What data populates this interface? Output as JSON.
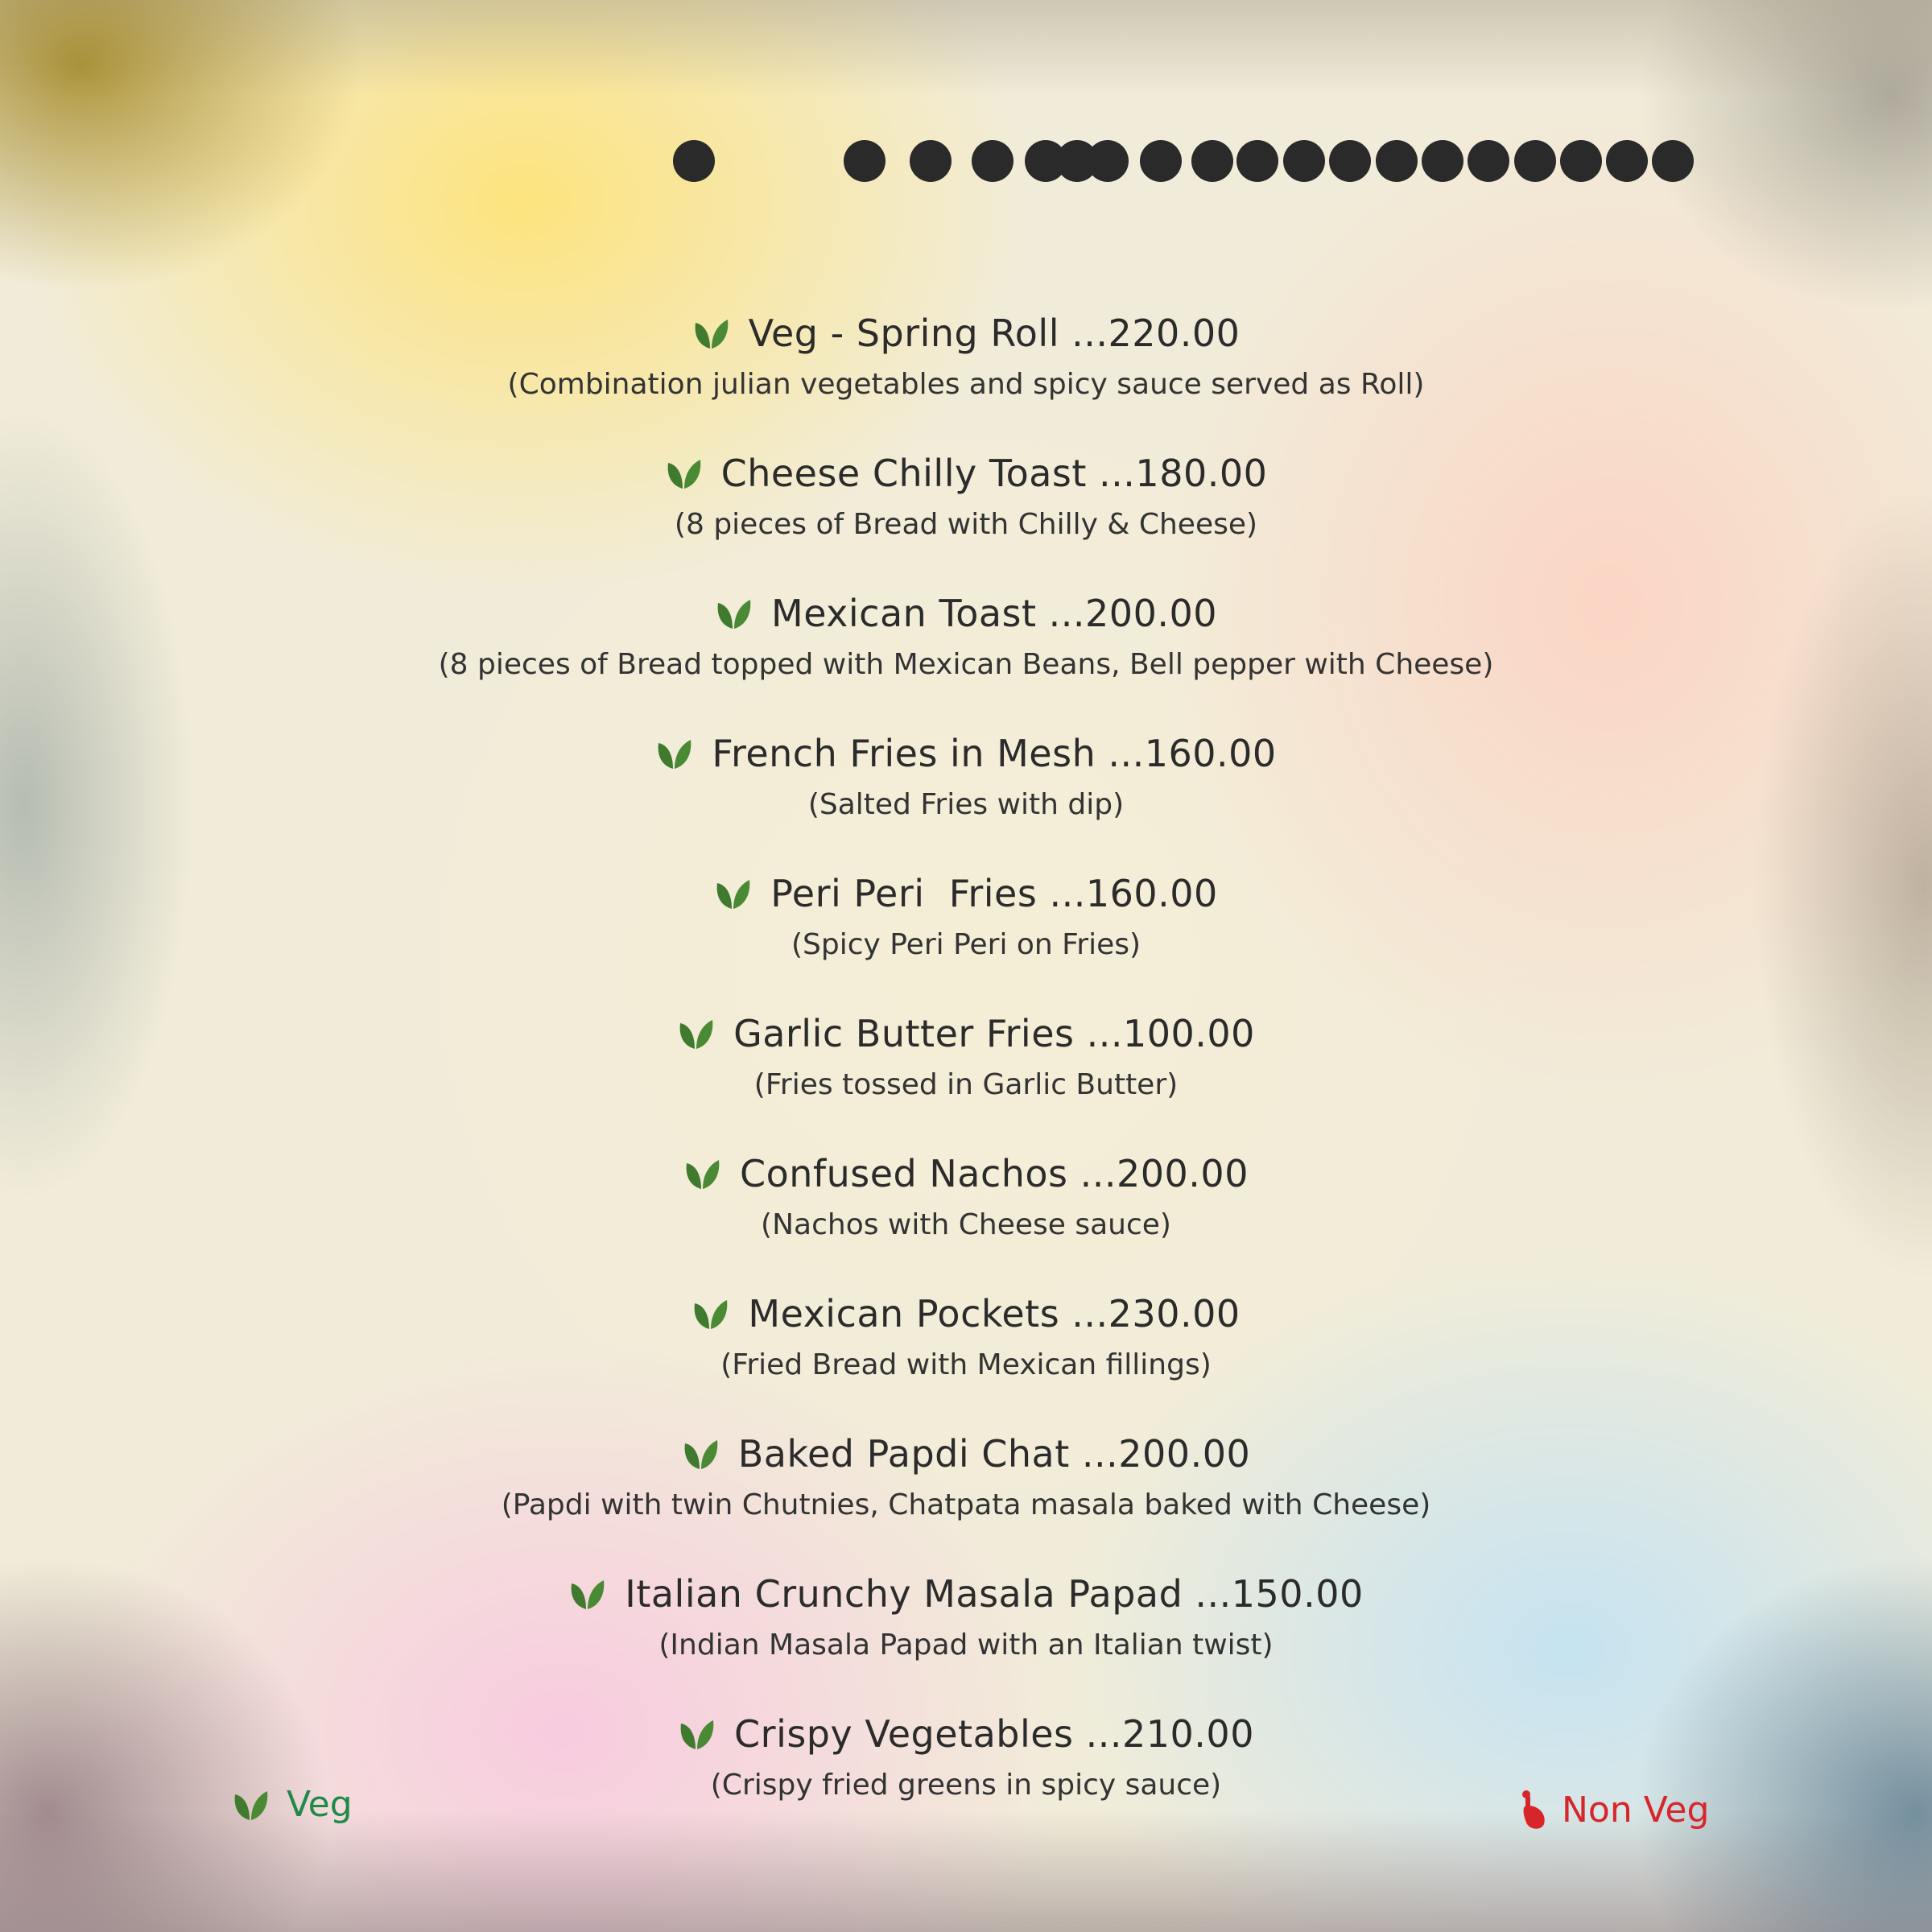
{
  "menu": {
    "items": [
      {
        "name": "Veg - Spring Roll ...220.00",
        "description": "(Combination julian vegetables and spicy sauce served as Roll)",
        "type": "veg"
      },
      {
        "name": "Cheese Chilly Toast ...180.00",
        "description": "(8 pieces of Bread with Chilly & Cheese)",
        "type": "veg"
      },
      {
        "name": "Mexican Toast ...200.00",
        "description": "(8 pieces of Bread topped with Mexican Beans, Bell pepper with Cheese)",
        "type": "veg"
      },
      {
        "name": "French Fries in Mesh ...160.00",
        "description": "(Salted Fries with dip)",
        "type": "veg"
      },
      {
        "name": "Peri Peri  Fries ...160.00",
        "description": "(Spicy Peri Peri on Fries)",
        "type": "veg"
      },
      {
        "name": "Garlic Butter Fries ...100.00",
        "description": "(Fries tossed in Garlic Butter)",
        "type": "veg"
      },
      {
        "name": "Confused Nachos ...200.00",
        "description": "(Nachos with Cheese sauce)",
        "type": "veg"
      },
      {
        "name": "Mexican Pockets ...230.00",
        "description": "(Fried Bread with Mexican fillings)",
        "type": "veg"
      },
      {
        "name": "Baked Papdi Chat ...200.00",
        "description": "(Papdi with twin Chutnies, Chatpata masala baked with Cheese)",
        "type": "veg"
      },
      {
        "name": "Italian Crunchy Masala Papad ...150.00",
        "description": "(Indian Masala Papad with an Italian twist)",
        "type": "veg"
      },
      {
        "name": "Crispy Vegetables ...210.00",
        "description": "(Crispy fried greens in spicy sauce)",
        "type": "veg"
      }
    ]
  },
  "legend": {
    "veg_label": "Veg",
    "nonveg_label": "Non Veg"
  },
  "icons": {
    "veg": "leaf-icon",
    "nonveg": "drumstick-icon"
  },
  "colors": {
    "veg": "#3f7a2e",
    "veg_label": "#1f8a4a",
    "nonveg": "#d6262c",
    "text": "#2b2b2b"
  }
}
